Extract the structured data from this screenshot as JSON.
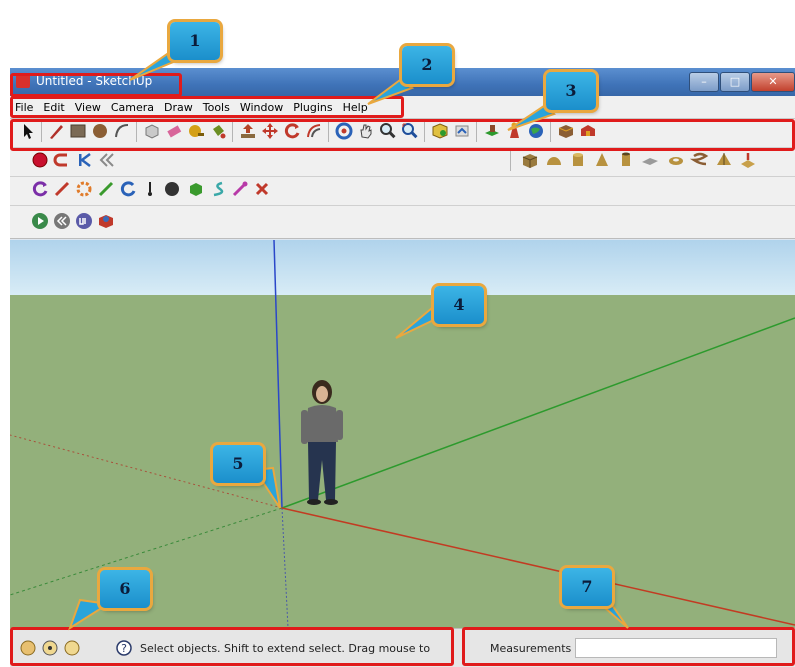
{
  "window": {
    "title": "Untitled - SketchUp"
  },
  "menu": {
    "items": [
      "File",
      "Edit",
      "View",
      "Camera",
      "Draw",
      "Tools",
      "Window",
      "Plugins",
      "Help"
    ]
  },
  "status": {
    "hint": "Select objects. Shift to extend select. Drag mouse to",
    "measurements_label": "Measurements",
    "measurements_value": ""
  },
  "callouts": [
    "1",
    "2",
    "3",
    "4",
    "5",
    "6",
    "7"
  ],
  "colors": {
    "highlight": "#e01b1b",
    "callout_fill": "#2aa4db",
    "callout_border": "#e9a83f",
    "sky": "#c3e1f1",
    "ground": "#93b07b",
    "axis_red": "#c23b22",
    "axis_green": "#2d9a2d",
    "axis_blue": "#2a47c9"
  }
}
